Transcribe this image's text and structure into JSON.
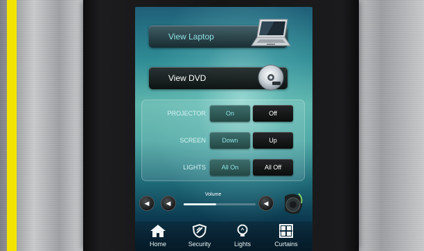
{
  "panel": {
    "view_laptop_label": "View Laptop",
    "view_dvd_label": "View DVD"
  },
  "controls": {
    "projector": {
      "label": "PROJECTOR",
      "left": "On",
      "right": "Off"
    },
    "screen": {
      "label": "SCREEN",
      "left": "Down",
      "right": "Up"
    },
    "lights": {
      "label": "LIGHTS",
      "left": "All On",
      "right": "All Off"
    }
  },
  "volume": {
    "label": "Volume",
    "level_fraction": 0.45
  },
  "nav": {
    "items": [
      {
        "label": "Home",
        "icon": "home-icon"
      },
      {
        "label": "Security",
        "icon": "shield-icon"
      },
      {
        "label": "Lights",
        "icon": "bulb-icon"
      },
      {
        "label": "Curtains",
        "icon": "curtains-icon"
      }
    ]
  },
  "colors": {
    "accent_text": "#8fe3e6",
    "side_strip": "#f2e400"
  }
}
